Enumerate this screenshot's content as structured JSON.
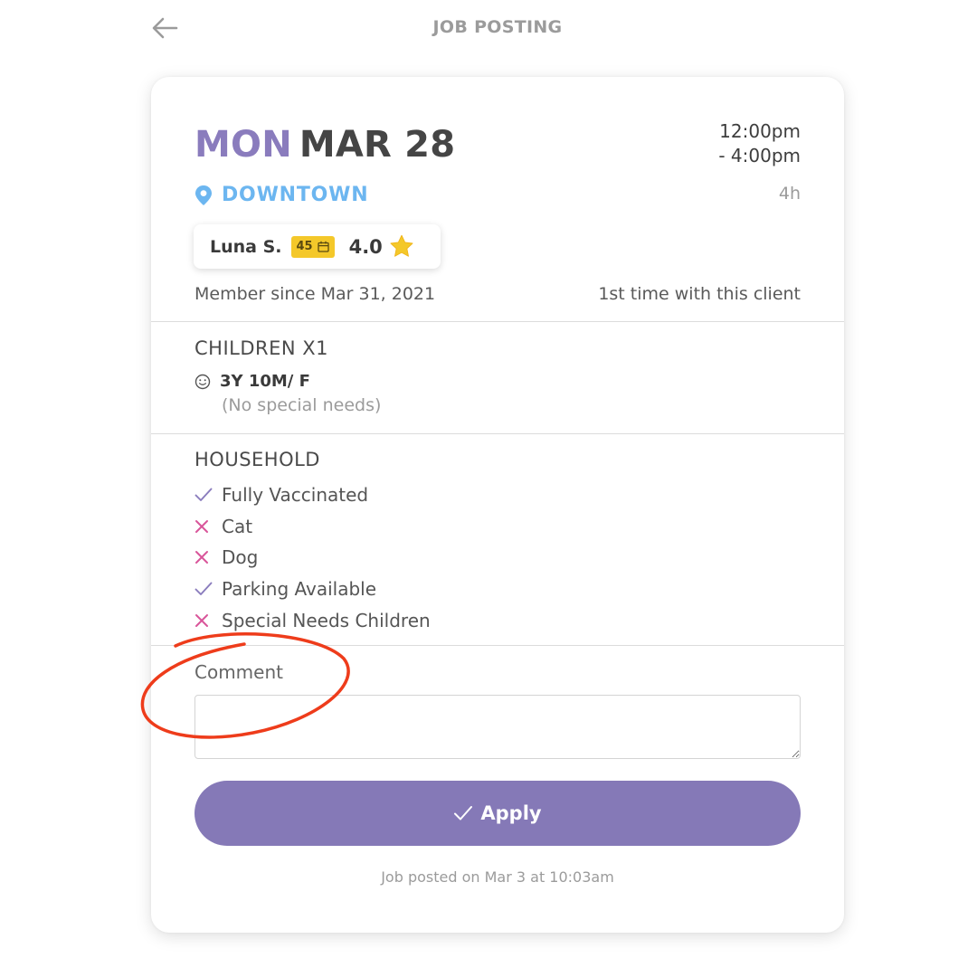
{
  "header": {
    "title": "JOB POSTING",
    "back_icon": "arrow-left-icon"
  },
  "job": {
    "day": "MON",
    "date": "MAR 28",
    "time_start": "12:00pm",
    "time_end": "- 4:00pm",
    "duration": "4h",
    "location": "DOWNTOWN",
    "location_icon": "map-pin-icon"
  },
  "sitter": {
    "name": "Luna S.",
    "jobs_count": "45",
    "rating": "4.0",
    "member_since": "Member since Mar 31, 2021",
    "relationship": "1st time with this client"
  },
  "children": {
    "title": "CHILDREN X1",
    "items": [
      {
        "description": "3Y 10M/ F",
        "note": "(No special needs)"
      }
    ]
  },
  "household": {
    "title": "HOUSEHOLD",
    "items": [
      {
        "label": "Fully Vaccinated",
        "status": "yes"
      },
      {
        "label": "Cat",
        "status": "no"
      },
      {
        "label": "Dog",
        "status": "no"
      },
      {
        "label": "Parking Available",
        "status": "yes"
      },
      {
        "label": "Special Needs Children",
        "status": "no"
      }
    ]
  },
  "comment": {
    "label": "Comment",
    "value": "",
    "placeholder": ""
  },
  "actions": {
    "apply_label": "Apply"
  },
  "footer": {
    "posted_on": "Job posted on Mar 3 at 10:03am"
  },
  "colors": {
    "accent_purple": "#8579b7",
    "location_blue": "#6cb6f0",
    "badge_yellow": "#f4c82a",
    "check_purple": "#8a7cbd",
    "cross_pink": "#d9559a",
    "annotation_red": "#ee3c1b"
  }
}
